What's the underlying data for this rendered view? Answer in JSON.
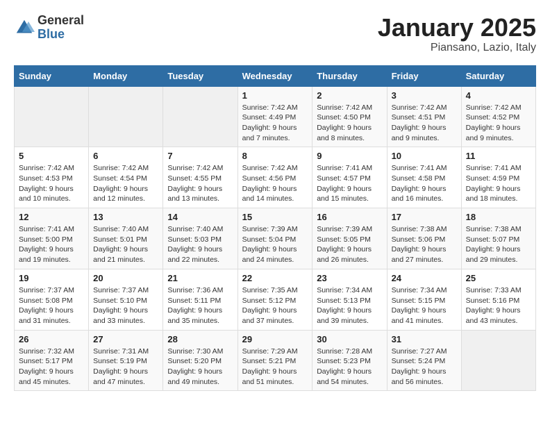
{
  "header": {
    "logo_general": "General",
    "logo_blue": "Blue",
    "month_title": "January 2025",
    "location": "Piansano, Lazio, Italy"
  },
  "days_of_week": [
    "Sunday",
    "Monday",
    "Tuesday",
    "Wednesday",
    "Thursday",
    "Friday",
    "Saturday"
  ],
  "weeks": [
    [
      {
        "day": "",
        "info": ""
      },
      {
        "day": "",
        "info": ""
      },
      {
        "day": "",
        "info": ""
      },
      {
        "day": "1",
        "info": "Sunrise: 7:42 AM\nSunset: 4:49 PM\nDaylight: 9 hours\nand 7 minutes."
      },
      {
        "day": "2",
        "info": "Sunrise: 7:42 AM\nSunset: 4:50 PM\nDaylight: 9 hours\nand 8 minutes."
      },
      {
        "day": "3",
        "info": "Sunrise: 7:42 AM\nSunset: 4:51 PM\nDaylight: 9 hours\nand 9 minutes."
      },
      {
        "day": "4",
        "info": "Sunrise: 7:42 AM\nSunset: 4:52 PM\nDaylight: 9 hours\nand 9 minutes."
      }
    ],
    [
      {
        "day": "5",
        "info": "Sunrise: 7:42 AM\nSunset: 4:53 PM\nDaylight: 9 hours\nand 10 minutes."
      },
      {
        "day": "6",
        "info": "Sunrise: 7:42 AM\nSunset: 4:54 PM\nDaylight: 9 hours\nand 12 minutes."
      },
      {
        "day": "7",
        "info": "Sunrise: 7:42 AM\nSunset: 4:55 PM\nDaylight: 9 hours\nand 13 minutes."
      },
      {
        "day": "8",
        "info": "Sunrise: 7:42 AM\nSunset: 4:56 PM\nDaylight: 9 hours\nand 14 minutes."
      },
      {
        "day": "9",
        "info": "Sunrise: 7:41 AM\nSunset: 4:57 PM\nDaylight: 9 hours\nand 15 minutes."
      },
      {
        "day": "10",
        "info": "Sunrise: 7:41 AM\nSunset: 4:58 PM\nDaylight: 9 hours\nand 16 minutes."
      },
      {
        "day": "11",
        "info": "Sunrise: 7:41 AM\nSunset: 4:59 PM\nDaylight: 9 hours\nand 18 minutes."
      }
    ],
    [
      {
        "day": "12",
        "info": "Sunrise: 7:41 AM\nSunset: 5:00 PM\nDaylight: 9 hours\nand 19 minutes."
      },
      {
        "day": "13",
        "info": "Sunrise: 7:40 AM\nSunset: 5:01 PM\nDaylight: 9 hours\nand 21 minutes."
      },
      {
        "day": "14",
        "info": "Sunrise: 7:40 AM\nSunset: 5:03 PM\nDaylight: 9 hours\nand 22 minutes."
      },
      {
        "day": "15",
        "info": "Sunrise: 7:39 AM\nSunset: 5:04 PM\nDaylight: 9 hours\nand 24 minutes."
      },
      {
        "day": "16",
        "info": "Sunrise: 7:39 AM\nSunset: 5:05 PM\nDaylight: 9 hours\nand 26 minutes."
      },
      {
        "day": "17",
        "info": "Sunrise: 7:38 AM\nSunset: 5:06 PM\nDaylight: 9 hours\nand 27 minutes."
      },
      {
        "day": "18",
        "info": "Sunrise: 7:38 AM\nSunset: 5:07 PM\nDaylight: 9 hours\nand 29 minutes."
      }
    ],
    [
      {
        "day": "19",
        "info": "Sunrise: 7:37 AM\nSunset: 5:08 PM\nDaylight: 9 hours\nand 31 minutes."
      },
      {
        "day": "20",
        "info": "Sunrise: 7:37 AM\nSunset: 5:10 PM\nDaylight: 9 hours\nand 33 minutes."
      },
      {
        "day": "21",
        "info": "Sunrise: 7:36 AM\nSunset: 5:11 PM\nDaylight: 9 hours\nand 35 minutes."
      },
      {
        "day": "22",
        "info": "Sunrise: 7:35 AM\nSunset: 5:12 PM\nDaylight: 9 hours\nand 37 minutes."
      },
      {
        "day": "23",
        "info": "Sunrise: 7:34 AM\nSunset: 5:13 PM\nDaylight: 9 hours\nand 39 minutes."
      },
      {
        "day": "24",
        "info": "Sunrise: 7:34 AM\nSunset: 5:15 PM\nDaylight: 9 hours\nand 41 minutes."
      },
      {
        "day": "25",
        "info": "Sunrise: 7:33 AM\nSunset: 5:16 PM\nDaylight: 9 hours\nand 43 minutes."
      }
    ],
    [
      {
        "day": "26",
        "info": "Sunrise: 7:32 AM\nSunset: 5:17 PM\nDaylight: 9 hours\nand 45 minutes."
      },
      {
        "day": "27",
        "info": "Sunrise: 7:31 AM\nSunset: 5:19 PM\nDaylight: 9 hours\nand 47 minutes."
      },
      {
        "day": "28",
        "info": "Sunrise: 7:30 AM\nSunset: 5:20 PM\nDaylight: 9 hours\nand 49 minutes."
      },
      {
        "day": "29",
        "info": "Sunrise: 7:29 AM\nSunset: 5:21 PM\nDaylight: 9 hours\nand 51 minutes."
      },
      {
        "day": "30",
        "info": "Sunrise: 7:28 AM\nSunset: 5:23 PM\nDaylight: 9 hours\nand 54 minutes."
      },
      {
        "day": "31",
        "info": "Sunrise: 7:27 AM\nSunset: 5:24 PM\nDaylight: 9 hours\nand 56 minutes."
      },
      {
        "day": "",
        "info": ""
      }
    ]
  ]
}
